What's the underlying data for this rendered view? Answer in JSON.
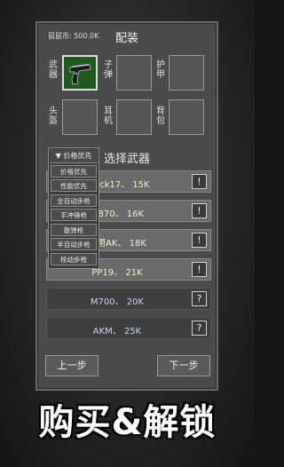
{
  "header": {
    "currency": "鼠鼠币: 500.0K",
    "title": "配装"
  },
  "slots": {
    "weapon": "武器",
    "ammo": "子弹",
    "armor": "护甲",
    "helmet": "头盔",
    "headset": "耳机",
    "backpack": "背包"
  },
  "select_title": "选择武器",
  "sort": {
    "current": "▼ 价格优先",
    "options": [
      "价格优先",
      "性能优先",
      "全自动步枪",
      "手冲锋枪",
      "散弹枪",
      "半自动步枪",
      "栓动步枪"
    ]
  },
  "weapons": [
    {
      "name": "Glock17、 15K",
      "status": "!"
    },
    {
      "name": "M870、 16K",
      "status": "!"
    },
    {
      "name": "民用AK、 18K",
      "status": "!"
    },
    {
      "name": "PP19、 21K",
      "status": "!"
    },
    {
      "name": "M700、 20K",
      "status": "?"
    },
    {
      "name": "AKM、 25K",
      "status": "?"
    }
  ],
  "nav": {
    "prev": "上一步",
    "next": "下一步"
  },
  "caption": "购买&解锁",
  "colors": {
    "panel": "#4a4a4a",
    "equipped_slot": "#1f5a1f",
    "unlocked_text": "#e8f5d0",
    "locked_text": "#c8d6ee"
  }
}
